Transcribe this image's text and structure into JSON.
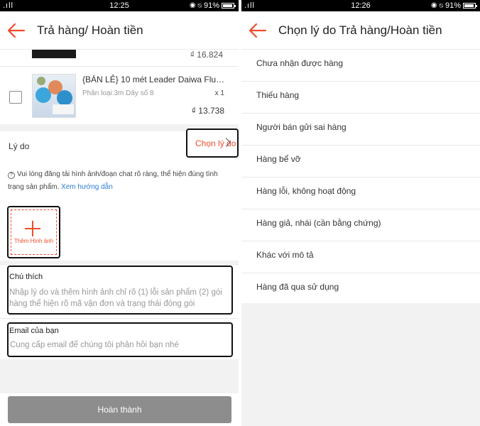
{
  "left_screen": {
    "status": {
      "signal": ".ıll",
      "time": "12:25",
      "battery": "91%"
    },
    "header": {
      "title": "Trả hàng/ Hoàn tiền"
    },
    "partial_product": {
      "price": "₫ 16.824"
    },
    "product": {
      "name": "{BÁN LẺ} 10 mét Leader Daiwa Fluor...",
      "variant": "Phân loại:3m Dây số 8",
      "quantity": "x 1",
      "price": "₫ 13.738"
    },
    "reason": {
      "label": "Lý do",
      "button_label": "Chọn lý do"
    },
    "notice": {
      "text": "Vui lòng đăng tải hình ảnh/đoạn chat rõ ràng, thể hiện đúng tình trạng sản phẩm.",
      "link": "Xem hướng dẫn"
    },
    "add_image": {
      "label": "Thêm Hình ảnh"
    },
    "note_field": {
      "label": "Chú thích",
      "placeholder": "Nhập lý do và thêm hình ảnh chỉ rõ (1) lỗi sản phẩm (2) gói hàng thể hiện rõ mã vận đơn và trạng thái đóng gói"
    },
    "email_field": {
      "label": "Email của bạn",
      "placeholder": "Cung cấp email để chúng tôi phản hồi bạn nhé"
    },
    "submit_label": "Hoàn thành"
  },
  "right_screen": {
    "status": {
      "signal": ".ıll",
      "time": "12:26",
      "battery": "91%"
    },
    "header": {
      "title": "Chọn lý do Trả hàng/Hoàn tiền"
    },
    "reasons": [
      "Chưa nhận được hàng",
      "Thiếu hàng",
      "Người bán gửi sai hàng",
      "Hàng bể vỡ",
      "Hàng lỗi, không hoạt động",
      "Hàng giả, nhái (cần bằng chứng)",
      "Khác với mô tả",
      "Hàng đã qua sử dụng"
    ]
  },
  "colors": {
    "accent": "#ee4d2d",
    "link": "#2a7bd4",
    "button_disabled": "#8d8d8d"
  }
}
